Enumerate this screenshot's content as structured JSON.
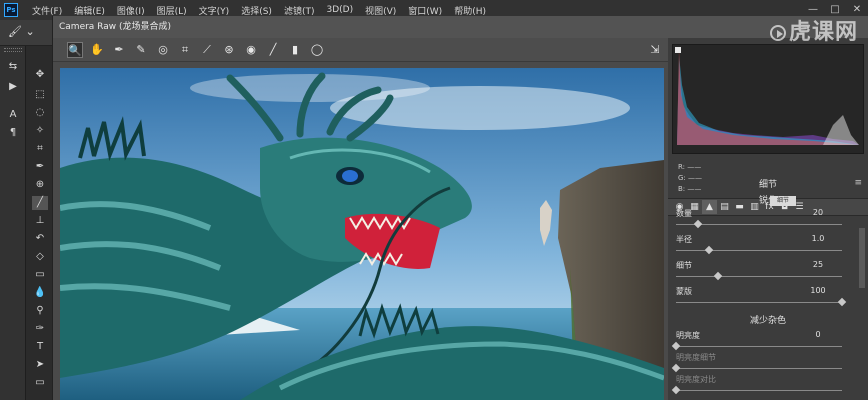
{
  "app": {
    "logo": "Ps"
  },
  "menu": [
    "文件(F)",
    "编辑(E)",
    "图像(I)",
    "图层(L)",
    "文字(Y)",
    "选择(S)",
    "滤镜(T)",
    "3D(D)",
    "视图(V)",
    "窗口(W)",
    "帮助(H)"
  ],
  "window_controls": [
    "—",
    "□",
    "✕"
  ],
  "dialog": {
    "title": "Camera Raw (龙场景合成)"
  },
  "histogram": {
    "r": "R:  ——",
    "g": "G:  ——",
    "b": "B:  ——"
  },
  "panel": {
    "section": "细节",
    "sharpen": "锐化",
    "tooltip": "细节",
    "noise": "减少杂色",
    "sliders": [
      {
        "label": "数量",
        "value": "20",
        "pos": 0.13
      },
      {
        "label": "半径",
        "value": "1.0",
        "pos": 0.2
      },
      {
        "label": "细节",
        "value": "25",
        "pos": 0.25
      },
      {
        "label": "蒙版",
        "value": "100",
        "pos": 1.0
      }
    ],
    "noise_sliders": [
      {
        "label": "明亮度",
        "value": "0",
        "pos": 0.0,
        "dim": false
      },
      {
        "label": "明亮度细节",
        "value": "",
        "pos": 0.0,
        "dim": true
      },
      {
        "label": "明亮度对比",
        "value": "",
        "pos": 0.0,
        "dim": true
      }
    ]
  },
  "watermark": "虎课网",
  "colors": {
    "sky": "#4f8fc4",
    "dragon": "#1e6a6a",
    "mouth": "#d0213a",
    "panel": "#3c3c3c"
  }
}
